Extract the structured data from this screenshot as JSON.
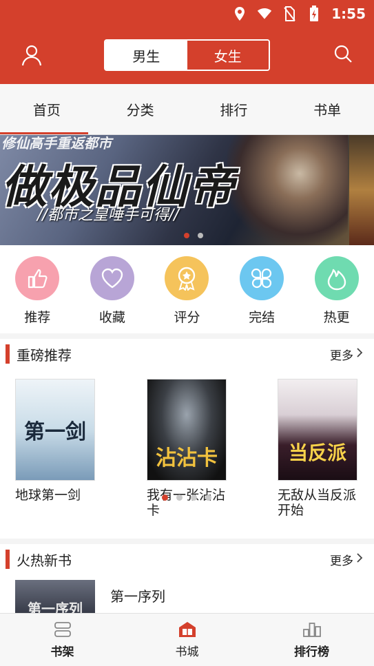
{
  "status_bar": {
    "time": "1:55",
    "icons": [
      "location-icon",
      "wifi-icon",
      "no-sim-icon",
      "battery-charging-icon"
    ]
  },
  "header": {
    "user_icon": "user-icon",
    "search_icon": "search-icon",
    "gender_tabs": [
      {
        "label": "男生",
        "selected": false
      },
      {
        "label": "女生",
        "selected": true
      }
    ]
  },
  "top_tabs": [
    {
      "label": "首页",
      "active": true
    },
    {
      "label": "分类",
      "active": false
    },
    {
      "label": "排行",
      "active": false
    },
    {
      "label": "书单",
      "active": false
    }
  ],
  "banner": {
    "top_text": "修仙高手重返都市",
    "title": "做极品仙帝",
    "subtitle": "//都市之皇唾手可得//",
    "current_slide": 1,
    "total_slides": 2
  },
  "categories": [
    {
      "label": "推荐",
      "icon": "thumbs-up-icon",
      "color": "#f7a1ae"
    },
    {
      "label": "收藏",
      "icon": "heart-icon",
      "color": "#b8a5d6"
    },
    {
      "label": "评分",
      "icon": "badge-icon",
      "color": "#f5c35b"
    },
    {
      "label": "完结",
      "icon": "clover-icon",
      "color": "#6cc7f0"
    },
    {
      "label": "热更",
      "icon": "flame-icon",
      "color": "#6fdbb0"
    }
  ],
  "featured": {
    "title": "重磅推荐",
    "more": "更多",
    "books": [
      {
        "title": "地球第一剑",
        "cover_text": "第一剑"
      },
      {
        "title": "我有一张沾沾卡",
        "cover_text": "沾沾卡"
      },
      {
        "title": "无敌从当反派开始",
        "cover_text": "当反派"
      }
    ],
    "current_page": 1,
    "total_pages": 4
  },
  "new_books": {
    "title": "火热新书",
    "more": "更多",
    "books": [
      {
        "title": "第一序列",
        "cover_text": "第一序列"
      }
    ]
  },
  "bottom_nav": [
    {
      "label": "书架",
      "icon": "bookshelf-icon",
      "active": false
    },
    {
      "label": "书城",
      "icon": "bookstore-icon",
      "active": true
    },
    {
      "label": "排行榜",
      "icon": "ranking-icon",
      "active": false
    }
  ],
  "colors": {
    "accent": "#d4402c"
  }
}
